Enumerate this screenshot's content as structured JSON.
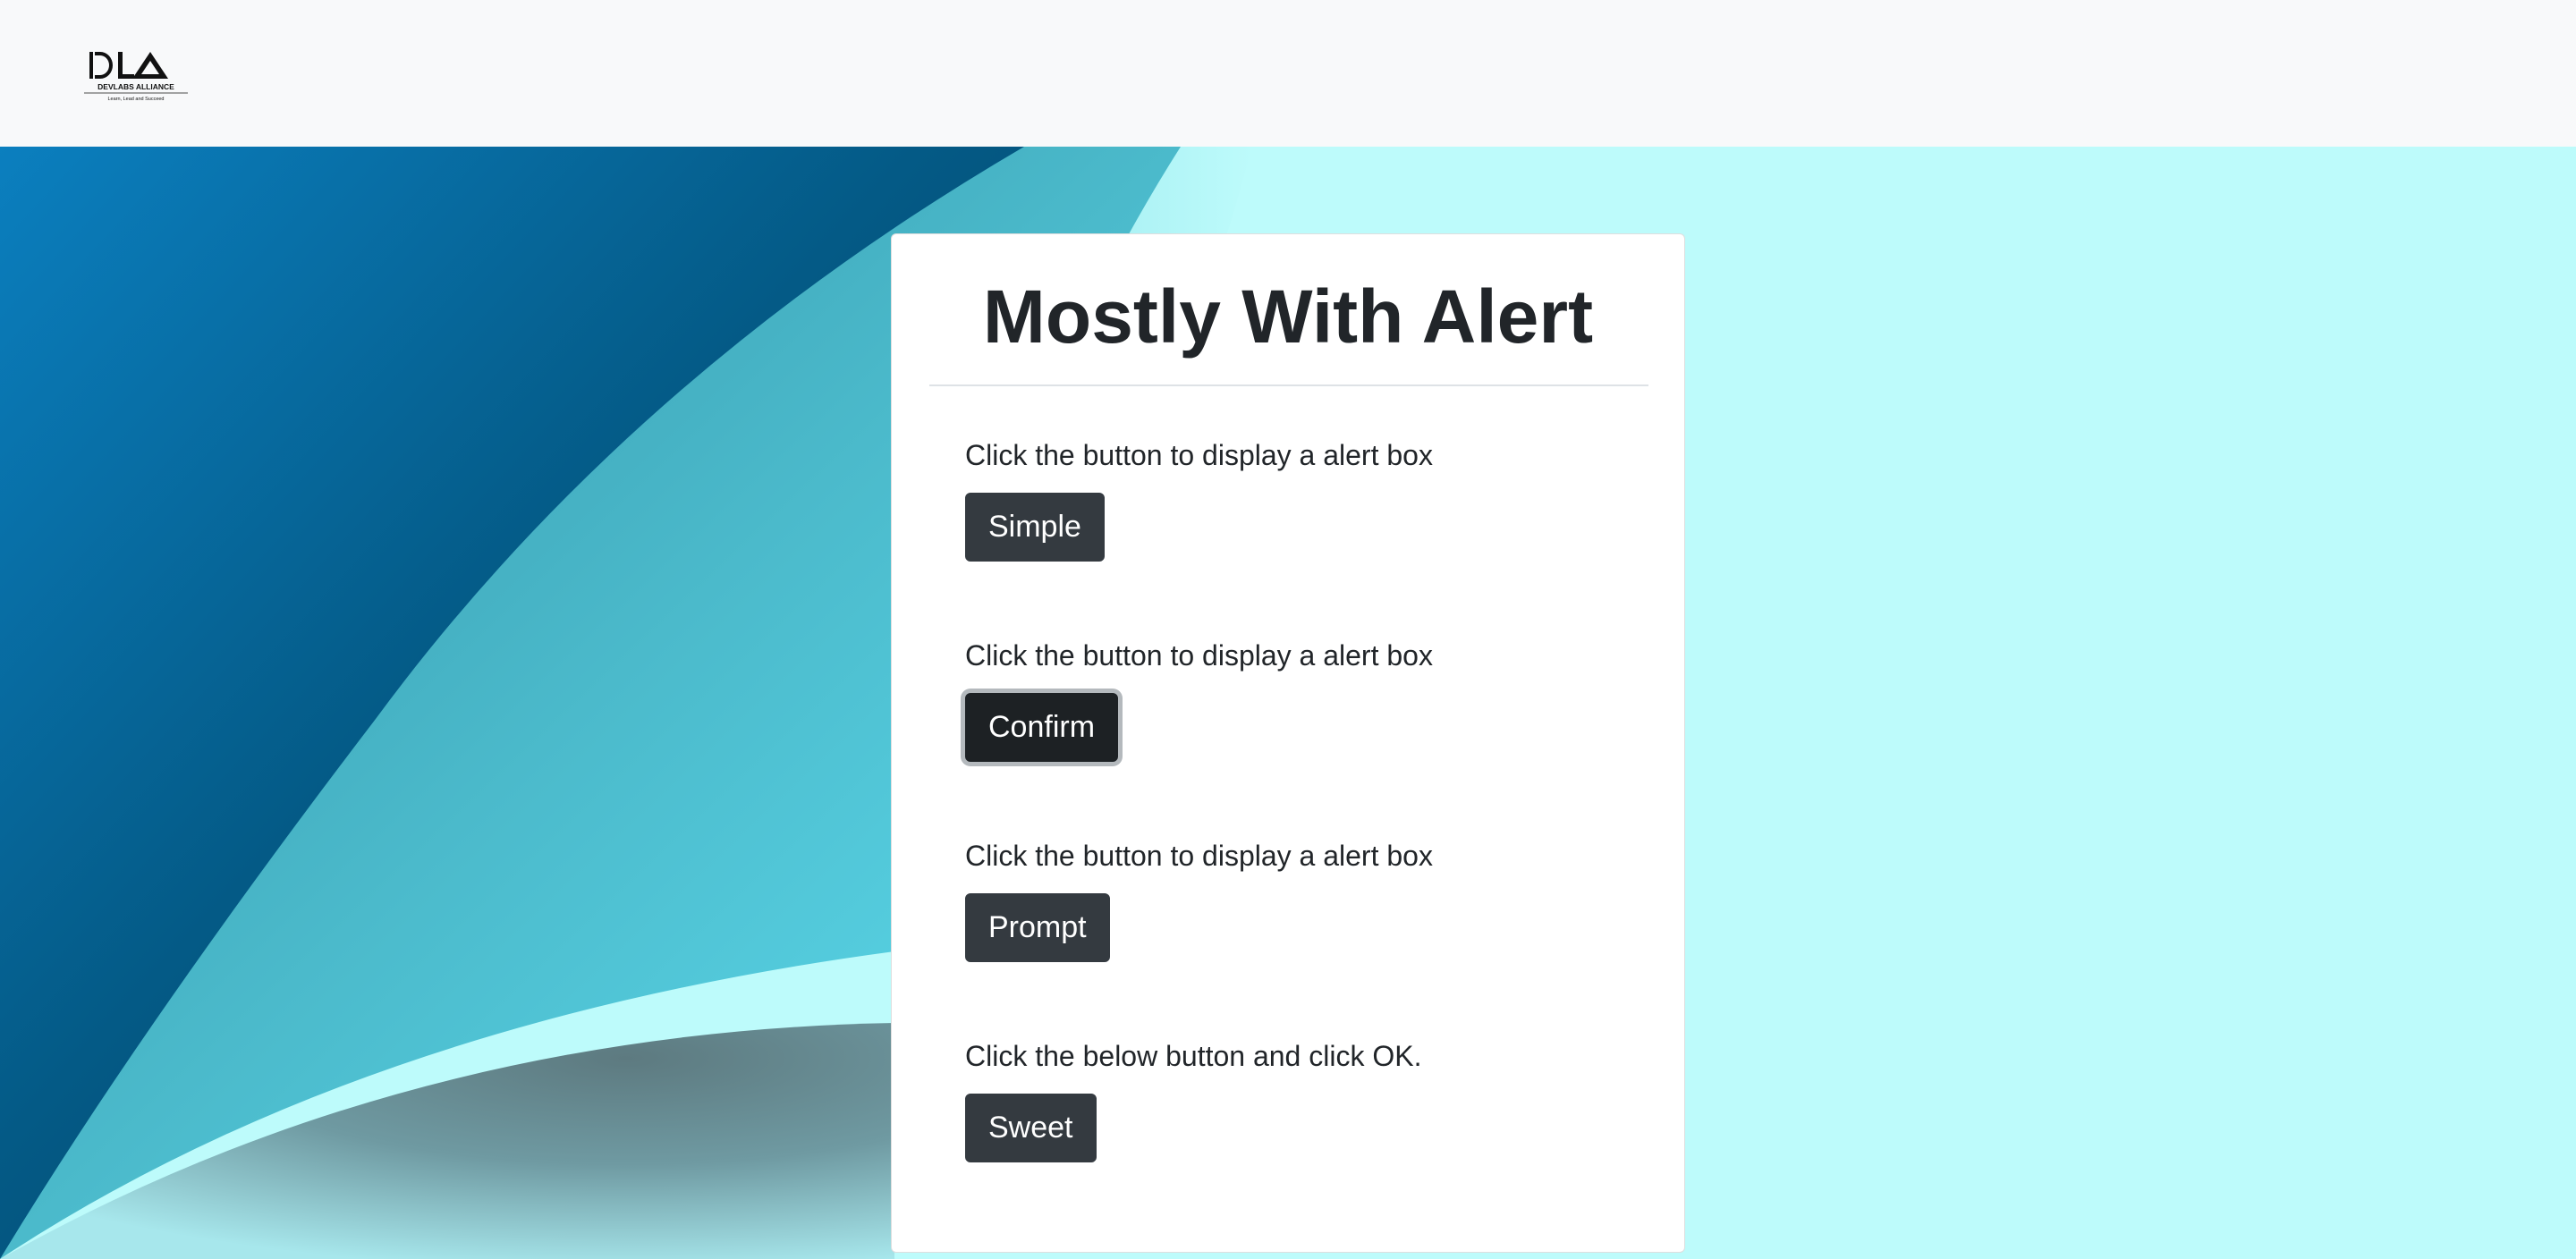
{
  "header": {
    "logo": {
      "monogram": "DLA",
      "name": "DEVLABS ALLIANCE",
      "tagline": "Learn, Lead and Succeed"
    }
  },
  "main": {
    "title": "Mostly With Alert",
    "sections": [
      {
        "text": "Click the button to display a alert box",
        "button": "Simple"
      },
      {
        "text": "Click the button to display a alert box",
        "button": "Confirm"
      },
      {
        "text": "Click the button to display a alert box",
        "button": "Prompt"
      },
      {
        "text": "Click the below button and click OK.",
        "button": "Sweet"
      }
    ]
  },
  "colors": {
    "navbar_bg": "#f8f9fa",
    "button_bg": "#343a40",
    "page_bg": "#bdfbfb"
  }
}
